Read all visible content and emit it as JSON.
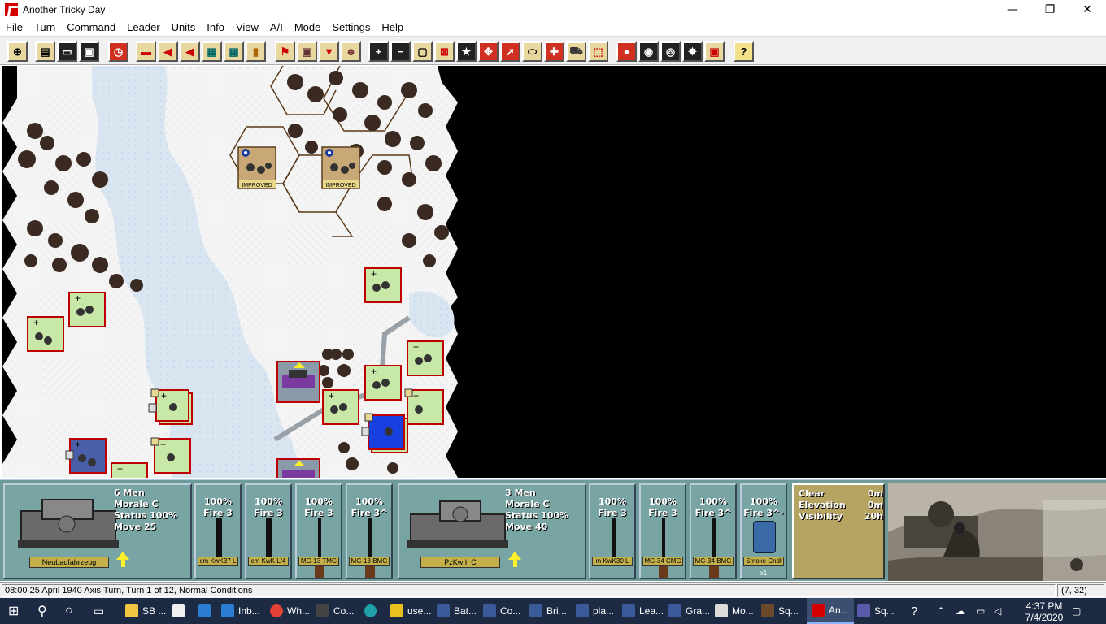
{
  "window": {
    "title": "Another Tricky Day",
    "min": "—",
    "max": "❐",
    "close": "✕"
  },
  "menu": [
    "File",
    "Turn",
    "Command",
    "Leader",
    "Units",
    "Info",
    "View",
    "A/I",
    "Mode",
    "Settings",
    "Help"
  ],
  "toolbar": {
    "buttons": [
      "goto-hex",
      "report",
      "load",
      "save",
      "combat-info",
      "fire",
      "retreat-red",
      "retreat",
      "map-view",
      "show-units",
      "ammo",
      "flag",
      "objectives",
      "drop-down",
      "leader",
      "zoom-in",
      "zoom-out",
      "frame",
      "frame-x",
      "star",
      "target",
      "arrow",
      "rally",
      "medic",
      "transport",
      "move-sel",
      "victory",
      "hide",
      "disk",
      "explosion",
      "group",
      "help"
    ],
    "zoom_in": "+",
    "zoom_out": "−",
    "help": "?"
  },
  "map": {
    "counters": [
      {
        "type": "improved-position",
        "label": "IMPROVED"
      },
      {
        "type": "improved-position",
        "label": "IMPROVED"
      }
    ]
  },
  "panel": {
    "unit1": {
      "men": "6 Men",
      "morale": "Morale C",
      "status": "Status 100%",
      "move": "Move 25",
      "name": "Neubaufahrzeug",
      "weapons": [
        {
          "pct": "100%",
          "fire": "Fire 3",
          "name": "cm KwK37 L"
        },
        {
          "pct": "100%",
          "fire": "Fire 3",
          "name": "cm KwK L/4"
        },
        {
          "pct": "100%",
          "fire": "Fire 3",
          "name": "MG-13 TMG"
        },
        {
          "pct": "100%",
          "fire": "Fire 3^",
          "name": "MG-13 BMG"
        }
      ]
    },
    "unit2": {
      "men": "3 Men",
      "morale": "Morale C",
      "status": "Status 100%",
      "move": "Move 40",
      "name": "PzKw II C",
      "weapons": [
        {
          "pct": "100%",
          "fire": "Fire 3",
          "name": "m KwK30 L"
        },
        {
          "pct": "100%",
          "fire": "Fire 3",
          "name": "MG-34 CMG"
        },
        {
          "pct": "100%",
          "fire": "Fire 3^",
          "name": "MG-34 BMG"
        },
        {
          "pct": "100%",
          "fire": "Fire 3^-",
          "name": "Smoke Cndl",
          "count": "x1"
        }
      ]
    },
    "terrain": {
      "type": "Clear",
      "type_value": "0m",
      "elevation_label": "Elevation",
      "elevation_value": "0m",
      "visibility_label": "Visibility",
      "visibility_value": "20h"
    }
  },
  "status": {
    "text": "08:00 25 April 1940 Axis Turn, Turn 1 of 12, Normal Conditions",
    "coords": "(7, 32)"
  },
  "taskbar": {
    "items": [
      "SB ...",
      "Inb...",
      "Wh...",
      "Co...",
      "use...",
      "Bat...",
      "Co...",
      "Bri...",
      "pla...",
      "Lea...",
      "Gra...",
      "Mo...",
      "Sq...",
      "An...",
      "Sq..."
    ],
    "time": "4:37 PM",
    "date": "7/4/2020"
  }
}
